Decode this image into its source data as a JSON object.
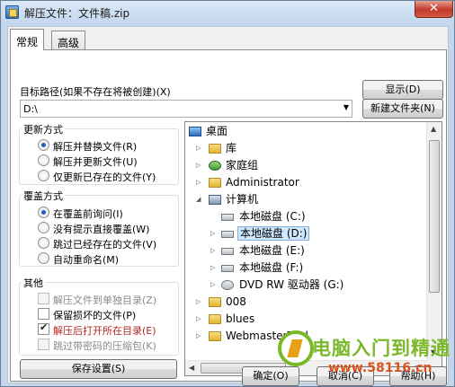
{
  "window": {
    "title": "解压文件：文件稿.zip",
    "close_glyph": "✕"
  },
  "tabs": [
    {
      "label": "常规",
      "active": true
    },
    {
      "label": "高级",
      "active": false
    }
  ],
  "destination": {
    "label": "目标路径(如果不存在将被创建)(X)",
    "value": "D:\\",
    "show_button": "显示(D)",
    "new_folder_button": "新建文件夹(N)"
  },
  "update_mode": {
    "legend": "更新方式",
    "options": [
      {
        "label": "解压并替换文件(R)",
        "selected": true
      },
      {
        "label": "解压并更新文件(U)",
        "selected": false
      },
      {
        "label": "仅更新已存在的文件(Y)",
        "selected": false
      }
    ]
  },
  "overwrite_mode": {
    "legend": "覆盖方式",
    "options": [
      {
        "label": "在覆盖前询问(I)",
        "selected": true
      },
      {
        "label": "没有提示直接覆盖(W)",
        "selected": false
      },
      {
        "label": "跳过已经存在的文件(V)",
        "selected": false
      },
      {
        "label": "自动重命名(M)",
        "selected": false
      }
    ]
  },
  "misc": {
    "legend": "其他",
    "options": [
      {
        "label": "解压文件到单独目录(Z)",
        "checked": false,
        "disabled": true
      },
      {
        "label": "保留损坏的文件(P)",
        "checked": false,
        "disabled": false
      },
      {
        "label": "解压后打开所在目录(E)",
        "checked": true,
        "disabled": false
      },
      {
        "label": "跳过带密码的压缩包(K)",
        "checked": false,
        "disabled": true
      }
    ]
  },
  "save_settings_button": "保存设置(S)",
  "tree": {
    "items": [
      {
        "label": "桌面",
        "icon": "desktop-icon"
      },
      {
        "label": "库",
        "icon": "library-folder-icon"
      },
      {
        "label": "家庭组",
        "icon": "homegroup-icon"
      },
      {
        "label": "Administrator",
        "icon": "user-folder-icon"
      },
      {
        "label": "计算机",
        "icon": "computer-icon"
      },
      {
        "label": "本地磁盘 (C:)",
        "icon": "drive-icon"
      },
      {
        "label": "本地磁盘 (D:)",
        "icon": "drive-icon",
        "selected": true
      },
      {
        "label": "本地磁盘 (E:)",
        "icon": "drive-icon"
      },
      {
        "label": "本地磁盘 (F:)",
        "icon": "drive-icon"
      },
      {
        "label": "DVD RW 驱动器 (G:)",
        "icon": "dvd-drive-icon"
      },
      {
        "label": "008",
        "icon": "folder-icon"
      },
      {
        "label": "blues",
        "icon": "folder-icon"
      },
      {
        "label": "WebmasterTool",
        "icon": "folder-icon"
      }
    ]
  },
  "buttons": {
    "ok": "确定(O)",
    "cancel": "取消(C)",
    "help": "帮助(H)"
  },
  "watermark": {
    "line1": "电脑入门到精通",
    "line2": "www.58116.cn"
  }
}
